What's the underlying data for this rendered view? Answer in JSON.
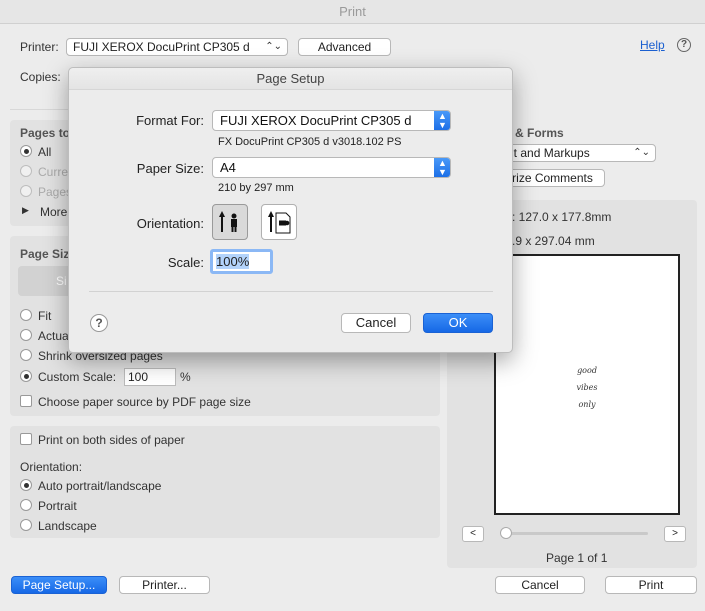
{
  "window": {
    "title": "Print"
  },
  "printer": {
    "label": "Printer:",
    "value": "FUJI XEROX DocuPrint CP305 d",
    "advanced_label": "Advanced",
    "help_label": "Help",
    "help_icon": "?"
  },
  "copies": {
    "label": "Copies:"
  },
  "pages_to_print": {
    "heading": "Pages to",
    "options": [
      "All",
      "Curre",
      "Pages"
    ],
    "more_label": "More"
  },
  "comments_forms": {
    "heading": "s & Forms",
    "value": "nt and Markups",
    "summarize_label": "rize Comments"
  },
  "page_size_info": {
    "line1": ": 127.0 x 177.8mm",
    "line2": ".9 x 297.04 mm"
  },
  "page_sizing": {
    "heading": "Page Siz",
    "size_tab_label": "Si",
    "options": [
      "Fit",
      "Actua",
      "Shrink oversized pages",
      "Custom Scale:"
    ],
    "custom_scale_value": "100",
    "percent": "%",
    "paper_source_label": "Choose paper source by PDF page size"
  },
  "both_sides": {
    "label": "Print on both sides of paper"
  },
  "orientation": {
    "label": "Orientation:",
    "options": [
      "Auto portrait/landscape",
      "Portrait",
      "Landscape"
    ]
  },
  "preview": {
    "script_lines": [
      "good",
      "vibes",
      "only"
    ],
    "prev_icon": "<",
    "next_icon": ">",
    "page_indicator": "Page 1 of 1",
    "slider_fraction": 0
  },
  "footer": {
    "page_setup_label": "Page Setup...",
    "printer_label": "Printer...",
    "cancel_label": "Cancel",
    "print_label": "Print"
  },
  "page_setup": {
    "title": "Page Setup",
    "format_for_label": "Format For:",
    "format_for_value": "FUJI XEROX DocuPrint CP305 d",
    "format_for_sub": "FX DocuPrint CP305 d v3018.102 PS",
    "paper_size_label": "Paper Size:",
    "paper_size_value": "A4",
    "paper_size_sub": "210 by 297 mm",
    "orientation_label": "Orientation:",
    "scale_label": "Scale:",
    "scale_value": "100%",
    "help_icon": "?",
    "cancel_label": "Cancel",
    "ok_label": "OK"
  },
  "colors": {
    "accent": "#1a6de6",
    "window_bg": "#ececec",
    "help_link": "#1a5fd0"
  }
}
